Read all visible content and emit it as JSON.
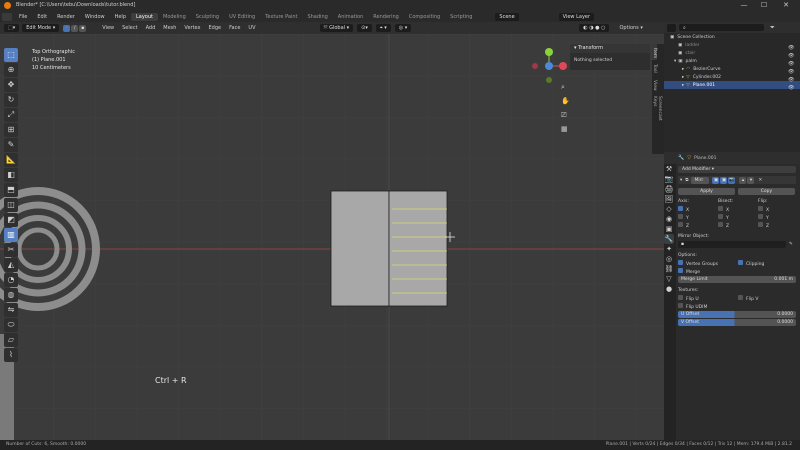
{
  "window": {
    "title": "Blender* [C:\\Users\\tebu\\Downloads\\tutor.blend]",
    "minimize": "—",
    "maximize": "☐",
    "close": "✕"
  },
  "menus": [
    "File",
    "Edit",
    "Render",
    "Window",
    "Help"
  ],
  "workspaces": [
    "Layout",
    "Modeling",
    "Sculpting",
    "UV Editing",
    "Texture Paint",
    "Shading",
    "Animation",
    "Rendering",
    "Compositing",
    "Scripting"
  ],
  "active_workspace": "Layout",
  "scene": {
    "label": "Scene",
    "view_layer": "View Layer"
  },
  "viewport_header": {
    "mode": "Edit Mode",
    "menus": [
      "View",
      "Select",
      "Add",
      "Mesh",
      "Vertex",
      "Edge",
      "Face",
      "UV"
    ],
    "transform_orientation": "Global",
    "options": "Options"
  },
  "viewport_info": {
    "view": "Top Orthographic",
    "object": "(1) Plane.001",
    "scale": "10 Centimeters"
  },
  "npanel": {
    "title": "Transform",
    "message": "Nothing selected",
    "tabs": [
      "Item",
      "Tool",
      "View",
      "Screencast Keys"
    ]
  },
  "overlay_hint": "Ctrl + R",
  "outliner": {
    "root": "Scene Collection",
    "rows": [
      {
        "name": "ladder",
        "indent": 1
      },
      {
        "name": "stair",
        "indent": 1
      },
      {
        "name": "palm",
        "indent": 1
      },
      {
        "name": "BezierCurve",
        "indent": 2
      },
      {
        "name": "Cylinder.002",
        "indent": 2
      },
      {
        "name": "Plane.001",
        "indent": 2,
        "selected": true
      }
    ]
  },
  "properties": {
    "object_name": "Plane.001",
    "add_modifier": "Add Modifier",
    "modifier_name": "Mirr",
    "apply": "Apply",
    "copy": "Copy",
    "axis_label": "Axis:",
    "bisect_label": "Bisect:",
    "flip_label": "Flip:",
    "axes": [
      "X",
      "Y",
      "Z"
    ],
    "mirror_object": "Mirror Object:",
    "options_label": "Options:",
    "vertex_groups": "Vertex Groups",
    "clipping": "Clipping",
    "merge": "Merge",
    "merge_limit_label": "Merge Limit",
    "merge_limit_value": "0.001 m",
    "textures_label": "Textures:",
    "flip_u": "Flip U",
    "flip_v": "Flip V",
    "flip_udim": "Flip UDIM",
    "u_offset_label": "U Offset",
    "u_offset_value": "0.0000",
    "v_offset_label": "V Offset",
    "v_offset_value": "0.0000"
  },
  "statusbar": {
    "left": "Number of Cuts: 6, Smooth: 0.0000",
    "right": "Plane.001 | Verts 0/24 | Edges 0/34 | Faces 0/12 | Tris 12 | Mem: 179.4 MiB | 2.81.2"
  },
  "colors": {
    "accent": "#4772b3",
    "selection_row": "#334d80",
    "viewport_bg": "#3b3b3b",
    "loop_cut_preview": "#d8d870",
    "x_axis_line": "#a54848"
  }
}
